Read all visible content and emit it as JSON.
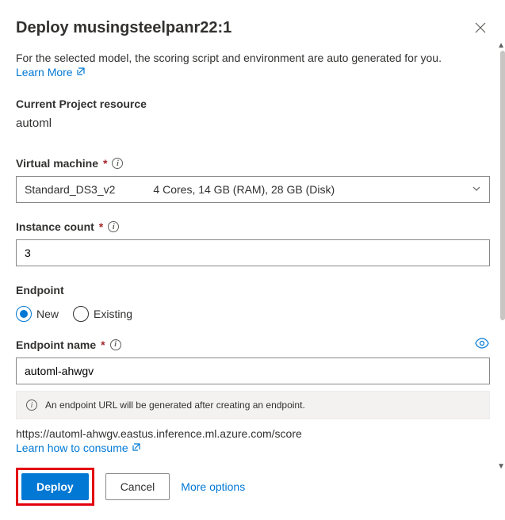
{
  "header": {
    "title": "Deploy musingsteelpanr22:1"
  },
  "intro": {
    "text": "For the selected model, the scoring script and environment are auto generated for you.",
    "learn_more_label": "Learn More"
  },
  "project_resource": {
    "label": "Current Project resource",
    "value": "automl"
  },
  "vm": {
    "label": "Virtual machine",
    "selected_name": "Standard_DS3_v2",
    "selected_specs": "4 Cores, 14 GB (RAM), 28 GB (Disk)"
  },
  "instance_count": {
    "label": "Instance count",
    "value": "3"
  },
  "endpoint": {
    "label": "Endpoint",
    "option_new": "New",
    "option_existing": "Existing",
    "selected": "new"
  },
  "endpoint_name": {
    "label": "Endpoint name",
    "value": "automl-ahwgv"
  },
  "info_bar": {
    "text": "An endpoint URL will be generated after creating an endpoint."
  },
  "url_preview": "https://automl-ahwgv.eastus.inference.ml.azure.com/score",
  "consume_link": "Learn how to consume",
  "footer": {
    "deploy_label": "Deploy",
    "cancel_label": "Cancel",
    "more_options_label": "More options"
  }
}
